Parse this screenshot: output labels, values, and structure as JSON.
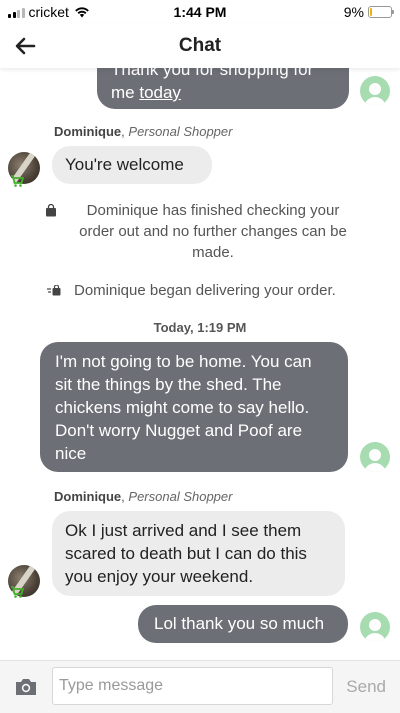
{
  "status_bar": {
    "carrier": "cricket",
    "time": "1:44 PM",
    "battery": "9%",
    "battery_level": 0.09
  },
  "header": {
    "title": "Chat"
  },
  "messages": {
    "m1": {
      "lines": [
        "Thank you for shopping for",
        "me "
      ],
      "link": "today"
    },
    "m2": {
      "sender_name": "Dominique",
      "sender_role": "Personal Shopper",
      "text": "You're welcome"
    },
    "m3": {
      "text": "Dominique has finished checking your order out and no further changes can be made."
    },
    "m4": {
      "text": "Dominique began delivering your order."
    },
    "m5": {
      "timestamp": "Today, 1:19 PM"
    },
    "m6": {
      "lines": [
        "I'm not going to be home. You can",
        "sit the things by the shed. The",
        "chickens might come to say hello.",
        "Don't worry Nugget and Poof are",
        "nice"
      ]
    },
    "m7": {
      "sender_name": "Dominique",
      "sender_role": "Personal Shopper",
      "lines": [
        "Ok I just arrived and I see them",
        "scared to death but I can do this",
        "you enjoy your weekend."
      ]
    },
    "m8": {
      "text": "Lol thank you so much"
    }
  },
  "input": {
    "placeholder": "Type message",
    "value": "",
    "send_label": "Send"
  },
  "colors": {
    "outgoing_bubble": "#6d6f76",
    "incoming_bubble": "#ececec",
    "avatar_green": "#a7dbb0",
    "cart_green": "#43b02a"
  }
}
